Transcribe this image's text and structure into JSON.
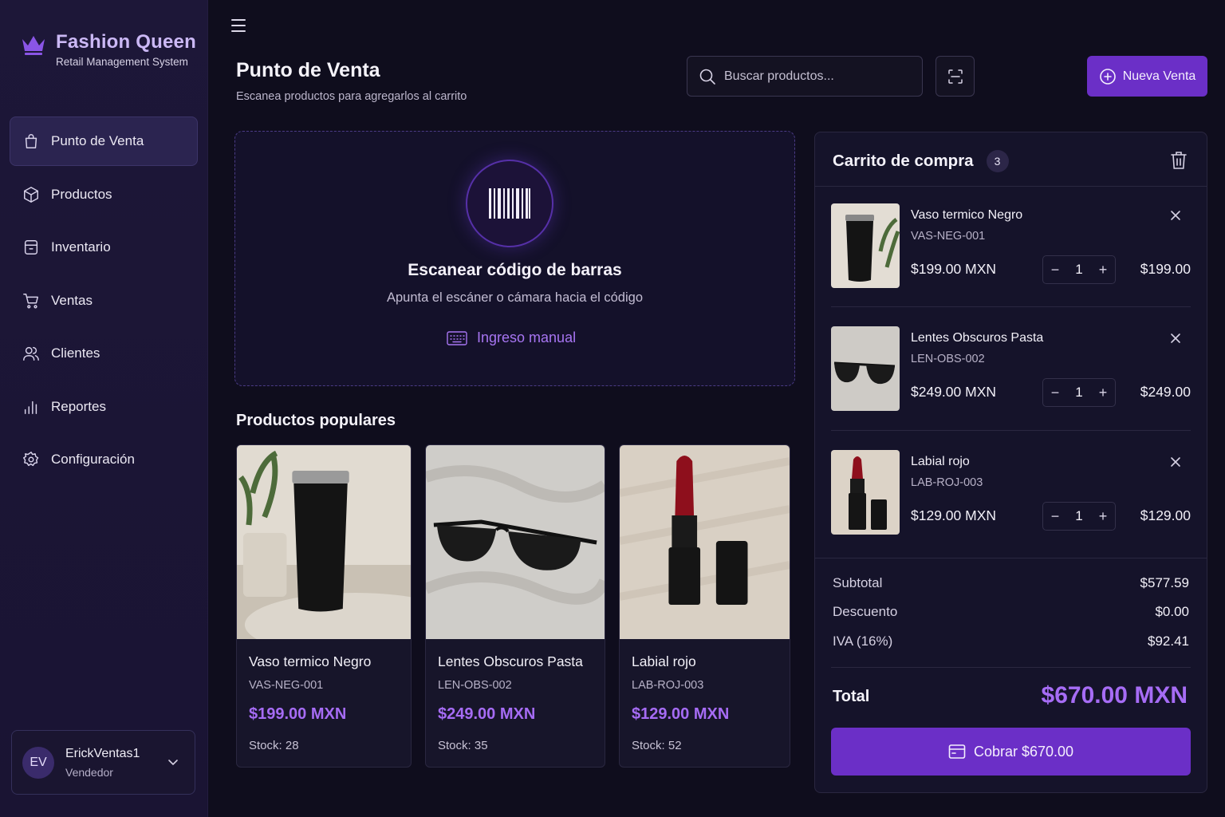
{
  "brand": {
    "title": "Fashion Queen",
    "subtitle": "Retail Management System",
    "accent": "#6b2fc7"
  },
  "sidebar": {
    "items": [
      {
        "label": "Punto de Venta",
        "icon": "shopping-bag-icon",
        "active": true
      },
      {
        "label": "Productos",
        "icon": "box-icon"
      },
      {
        "label": "Inventario",
        "icon": "archive-icon"
      },
      {
        "label": "Ventas",
        "icon": "cart-icon"
      },
      {
        "label": "Clientes",
        "icon": "users-icon"
      },
      {
        "label": "Reportes",
        "icon": "bar-chart-icon"
      },
      {
        "label": "Configuración",
        "icon": "gear-icon"
      }
    ]
  },
  "user": {
    "initials": "EV",
    "name": "ErickVentas1",
    "role": "Vendedor"
  },
  "header": {
    "title": "Punto de Venta",
    "subtitle": "Escanea productos para agregarlos al carrito",
    "search_placeholder": "Buscar productos...",
    "new_sale_label": "Nueva Venta"
  },
  "scanner": {
    "title": "Escanear código de barras",
    "subtitle": "Apunta el escáner o cámara hacia el código",
    "manual_label": "Ingreso manual"
  },
  "popular": {
    "title": "Productos populares",
    "products": [
      {
        "name": "Vaso termico Negro",
        "sku": "VAS-NEG-001",
        "price": "$199.00 MXN",
        "stock": "Stock: 28"
      },
      {
        "name": "Lentes Obscuros Pasta",
        "sku": "LEN-OBS-002",
        "price": "$249.00 MXN",
        "stock": "Stock: 35"
      },
      {
        "name": "Labial rojo",
        "sku": "LAB-ROJ-003",
        "price": "$129.00 MXN",
        "stock": "Stock: 52"
      }
    ]
  },
  "cart": {
    "title": "Carrito de compra",
    "count": "3",
    "items": [
      {
        "name": "Vaso termico Negro",
        "sku": "VAS-NEG-001",
        "price": "$199.00 MXN",
        "qty": "1",
        "line_total": "$199.00"
      },
      {
        "name": "Lentes Obscuros Pasta",
        "sku": "LEN-OBS-002",
        "price": "$249.00 MXN",
        "qty": "1",
        "line_total": "$249.00"
      },
      {
        "name": "Labial rojo",
        "sku": "LAB-ROJ-003",
        "price": "$129.00 MXN",
        "qty": "1",
        "line_total": "$129.00"
      }
    ],
    "summary": {
      "subtotal_label": "Subtotal",
      "subtotal": "$577.59",
      "discount_label": "Descuento",
      "discount": "$0.00",
      "tax_label": "IVA (16%)",
      "tax": "$92.41",
      "total_label": "Total",
      "total": "$670.00 MXN"
    },
    "pay_label": "Cobrar $670.00"
  }
}
